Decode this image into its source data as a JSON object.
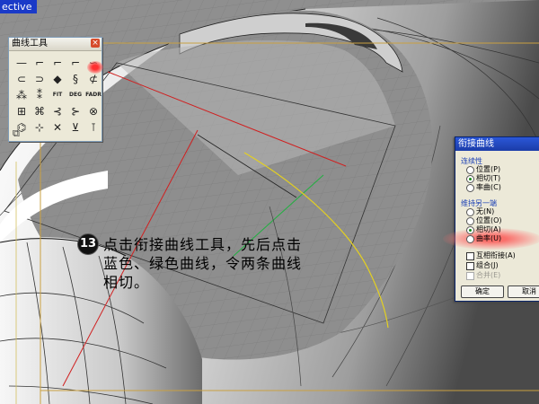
{
  "viewport": {
    "label": "ective"
  },
  "palette": {
    "title": "曲线工具",
    "close": "×",
    "tools": [
      {
        "icon": "line-icon",
        "glyph": "—"
      },
      {
        "icon": "fillet-curve-icon",
        "glyph": "⌐"
      },
      {
        "icon": "chamfer-curve-icon",
        "glyph": "⌐"
      },
      {
        "icon": "connect-curve-icon",
        "glyph": "⌐"
      },
      {
        "icon": "blend-curve-icon",
        "glyph": "∽"
      },
      {
        "icon": "offset-curve-icon",
        "glyph": "⊂"
      },
      {
        "icon": "arc-blend-icon",
        "glyph": "⊃"
      },
      {
        "icon": "extend-curve-icon",
        "glyph": "◆"
      },
      {
        "icon": "match-curve-icon",
        "glyph": "§"
      },
      {
        "icon": "curve-from-2-views-icon",
        "glyph": "⊄"
      },
      {
        "icon": "rebuild-curve-icon",
        "glyph": "⁂"
      },
      {
        "icon": "project-curve-icon",
        "glyph": "⁑"
      },
      {
        "text": "FIT",
        "icon": "fit-curve-icon"
      },
      {
        "text": "DEG",
        "icon": "change-degree-icon"
      },
      {
        "text": "FADR",
        "icon": "fair-curve-icon"
      },
      {
        "icon": "crv-start-icon",
        "glyph": "⊞"
      },
      {
        "icon": "smooth-curve-icon",
        "glyph": "⌘"
      },
      {
        "icon": "simplify-curve-icon",
        "glyph": "⊰"
      },
      {
        "icon": "symmetric-curve-icon",
        "glyph": "⊱"
      },
      {
        "icon": "curve-boolean-icon",
        "glyph": "⊗"
      },
      {
        "icon": "handle-curve-icon",
        "glyph": "⌬"
      },
      {
        "icon": "curve-on-surface-icon",
        "glyph": "⊹"
      },
      {
        "icon": "remove-knot-icon",
        "glyph": "✕"
      },
      {
        "icon": "insert-knot-icon",
        "glyph": "⊻"
      },
      {
        "icon": "adjust-seam-icon",
        "glyph": "⊺"
      }
    ],
    "footer_icon": "copy-icon"
  },
  "annotation": {
    "number": "13",
    "text": "点击衔接曲线工具，先后点击蓝色、绿色曲线，令两条曲线相切。"
  },
  "dialog": {
    "title": "衔接曲线",
    "continuity_group": "连续性",
    "continuity_options": [
      {
        "label": "位置(P)",
        "checked": false
      },
      {
        "label": "相切(T)",
        "checked": true
      },
      {
        "label": "率曲(C)",
        "checked": false
      }
    ],
    "maintain_group": "维持另一端",
    "maintain_options": [
      {
        "label": "无(N)",
        "checked": false
      },
      {
        "label": "位置(O)",
        "checked": false
      },
      {
        "label": "相切(A)",
        "checked": true
      },
      {
        "label": "曲率(U)",
        "checked": false
      }
    ],
    "checkboxes": [
      {
        "label": "互相衔接(A)",
        "disabled": false
      },
      {
        "label": "组合(J)",
        "disabled": false
      },
      {
        "label": "合并(E)",
        "disabled": true
      }
    ],
    "ok_label": "确定",
    "cancel_label": "取消"
  }
}
